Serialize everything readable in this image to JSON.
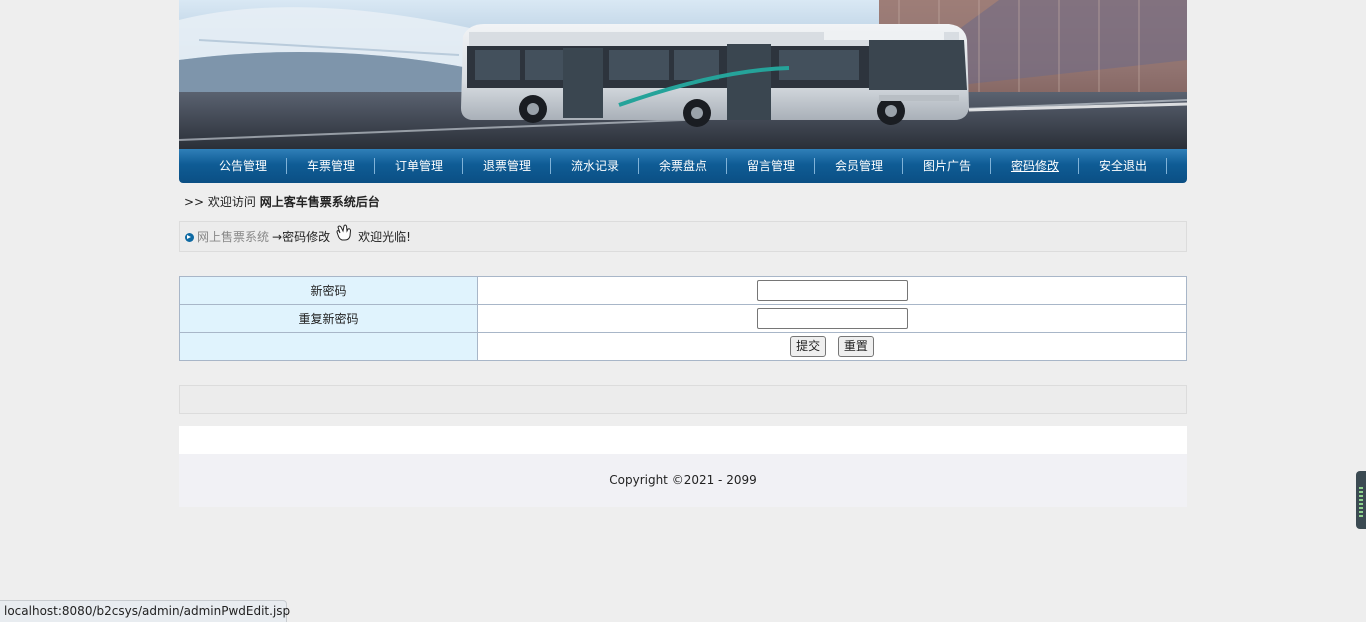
{
  "nav": {
    "items": [
      {
        "label": "公告管理"
      },
      {
        "label": "车票管理"
      },
      {
        "label": "订单管理"
      },
      {
        "label": "退票管理"
      },
      {
        "label": "流水记录"
      },
      {
        "label": "余票盘点"
      },
      {
        "label": "留言管理"
      },
      {
        "label": "会员管理"
      },
      {
        "label": "图片广告"
      },
      {
        "label": "密码修改"
      },
      {
        "label": "安全退出"
      }
    ]
  },
  "welcome": {
    "prefix": ">> 欢迎访问 ",
    "site_name": "网上客车售票系统后台"
  },
  "breadcrumb": {
    "home": "网上售票系统",
    "current": "→密码修改",
    "greeting": "欢迎光临!"
  },
  "form": {
    "new_password_label": "新密码",
    "repeat_password_label": "重复新密码",
    "new_password_value": "",
    "repeat_password_value": "",
    "submit_label": "提交",
    "reset_label": "重置"
  },
  "footer": {
    "copyright": "Copyright ©2021 - 2099"
  },
  "status_bar": {
    "url": "localhost:8080/b2csys/admin/adminPwdEdit.jsp"
  }
}
